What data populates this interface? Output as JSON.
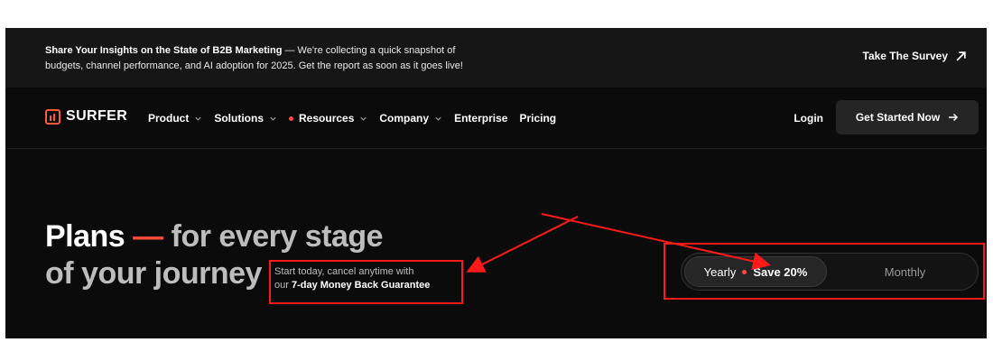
{
  "banner": {
    "headline": "Share Your Insights on the State of B2B Marketing",
    "body_line1": " — We're collecting a quick snapshot of",
    "body_line2": "budgets, channel performance, and AI adoption for 2025. Get the report as soon as it goes live!",
    "survey_label": "Take The Survey"
  },
  "nav": {
    "logo": "SURFER",
    "items": [
      {
        "label": "Product",
        "dropdown": true,
        "dot": false
      },
      {
        "label": "Solutions",
        "dropdown": true,
        "dot": false
      },
      {
        "label": "Resources",
        "dropdown": true,
        "dot": true
      },
      {
        "label": "Company",
        "dropdown": true,
        "dot": false
      },
      {
        "label": "Enterprise",
        "dropdown": false,
        "dot": false
      },
      {
        "label": "Pricing",
        "dropdown": false,
        "dot": false
      }
    ],
    "login": "Login",
    "cta": "Get Started Now"
  },
  "hero": {
    "title_strong": "Plans",
    "title_dash": "—",
    "title_rest": "for every stage",
    "title_line2": "of your journey",
    "note_line1": "Start today, cancel anytime with",
    "note_prefix": "our ",
    "note_bold": "7-day Money Back Guarantee"
  },
  "billing_toggle": {
    "active_label": "Yearly",
    "discount": "Save 20%",
    "inactive_label": "Monthly"
  },
  "colors": {
    "accent": "#ff4b3a",
    "annotation": "#ff1a1a",
    "background": "#0b0b0c"
  }
}
